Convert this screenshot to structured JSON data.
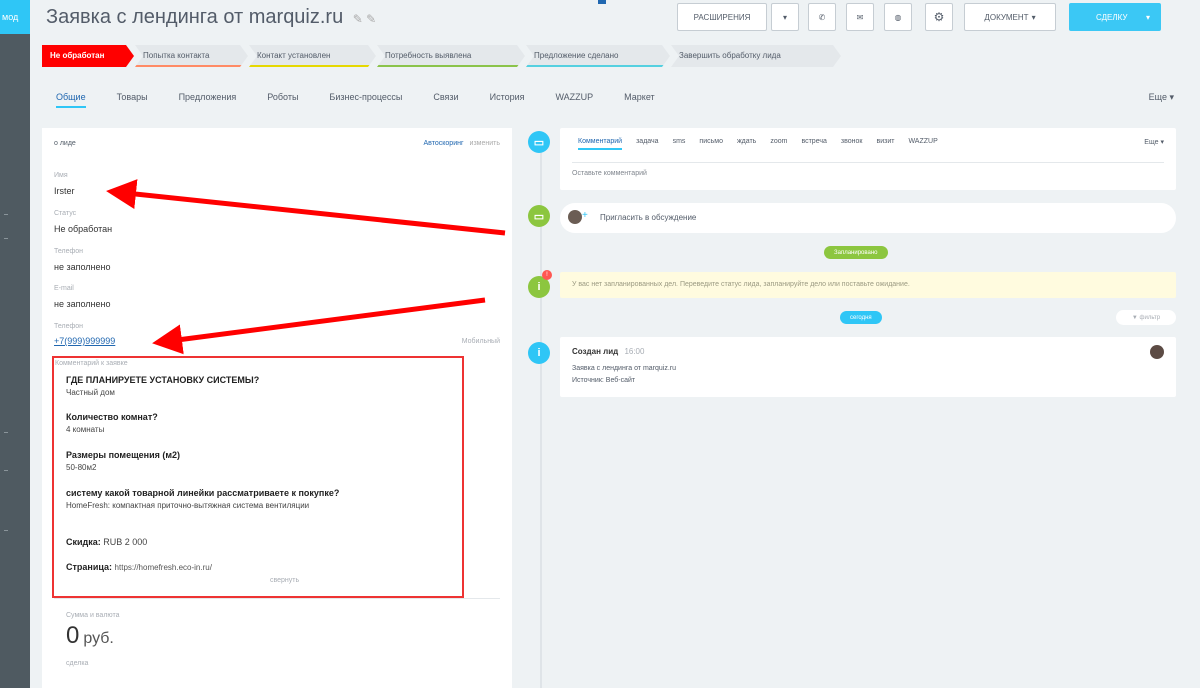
{
  "sidebar": {
    "tab_label": "мод"
  },
  "header": {
    "title": "Заявка с лендинга от marquiz.ru",
    "buttons": {
      "extensions": "расширения",
      "document": "документ",
      "deal": "сделку"
    }
  },
  "stages": [
    {
      "label": "Не обработан",
      "color": "#ff0000"
    },
    {
      "label": "Попытка контакта",
      "color": "#ff8a65"
    },
    {
      "label": "Контакт установлен",
      "color": "#e6d800"
    },
    {
      "label": "Потребность выявлена",
      "color": "#8bc34a"
    },
    {
      "label": "Предложение сделано",
      "color": "#55d0e0"
    },
    {
      "label": "Завершить обработку лида",
      "color": "#e4e8eb"
    }
  ],
  "nav": {
    "tabs": [
      "Общие",
      "Товары",
      "Предложения",
      "Роботы",
      "Бизнес-процессы",
      "Связи",
      "История",
      "WAZZUP",
      "Маркет"
    ],
    "more": "Еще"
  },
  "left_panel": {
    "header": "о лиде",
    "header_actions": {
      "autodial": "Автоскоринг",
      "edit": "изменить"
    },
    "fields": [
      {
        "label": "Имя",
        "value": "Irster"
      },
      {
        "label": "Статус",
        "value": "Не обработан"
      },
      {
        "label": "Телефон",
        "value": "не заполнено"
      },
      {
        "label": "E-mail",
        "value": "не заполнено"
      },
      {
        "label": "Телефон",
        "value": "+7(999)999999",
        "aside": "Мобильный"
      }
    ],
    "comment": {
      "label": "Комментарий к заявке",
      "items": [
        {
          "q": "ГДЕ ПЛАНИРУЕТЕ УСТАНОВКУ СИСТЕМЫ?",
          "a": "Частный дом"
        },
        {
          "q": "Количество комнат?",
          "a": "4 комнаты"
        },
        {
          "q": "Размеры помещения (м2)",
          "a": "50-80м2"
        },
        {
          "q": "систему какой товарной линейки рассматриваете к покупке?",
          "a": "HomeFresh: компактная приточно-вытяжная система вентиляции"
        }
      ],
      "discount_label": "Скидка:",
      "discount_value": "RUB 2 000",
      "page_label": "Страница:",
      "page_value": "https://homefresh.eco-in.ru/",
      "collapse": "свернуть"
    },
    "amount_label": "Сумма и валюта",
    "amount_value": "0",
    "amount_currency": "руб.",
    "bottom_label": "сделка"
  },
  "timeline": {
    "tabs": [
      "Комментарий",
      "задача",
      "sms",
      "письмо",
      "ждать",
      "zoom",
      "встреча",
      "звонок",
      "визит",
      "WAZZUP"
    ],
    "tabs_more": "Еще",
    "comment_placeholder": "Оставьте комментарий",
    "invite": "Пригласить в обсуждение",
    "scheduled_pill": "Запланировано",
    "notice": "У вас нет запланированных дел. Переведите статус лида, запланируйте дело или поставьте ожидание.",
    "today_pill": "сегодня",
    "filter": "фильтр",
    "created_title": "Создан лид",
    "created_time": "16:00",
    "created_line1": "Заявка с лендинга от marquiz.ru",
    "created_line2": "Источник: Веб-сайт"
  }
}
